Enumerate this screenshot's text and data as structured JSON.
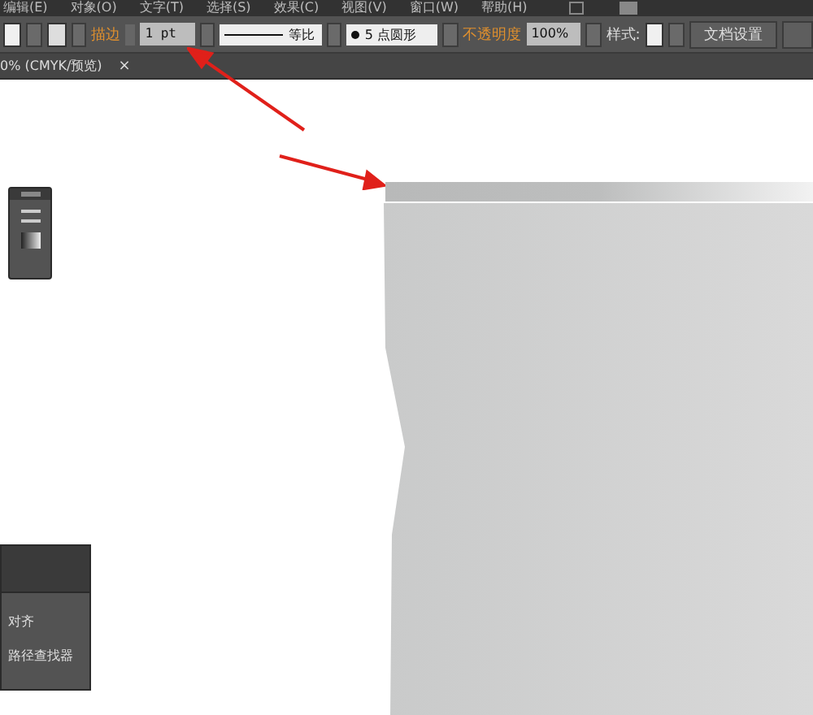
{
  "menu_bar": {
    "items": [
      "编辑(E)",
      "对象(O)",
      "文字(T)",
      "选择(S)",
      "效果(C)",
      "视图(V)",
      "窗口(W)",
      "帮助(H)"
    ]
  },
  "control_bar": {
    "stroke_label": "描边",
    "stroke_weight": "1 pt",
    "profile": "等比",
    "brush": "5 点圆形",
    "opacity_label": "不透明度",
    "opacity": "100%",
    "style_label": "样式:",
    "document_setup": "文档设置"
  },
  "document_tab": {
    "title": "0% (CMYK/预览)",
    "close": "×"
  },
  "panels": [
    {
      "items": [
        "对齐",
        "路径查找器"
      ]
    }
  ]
}
